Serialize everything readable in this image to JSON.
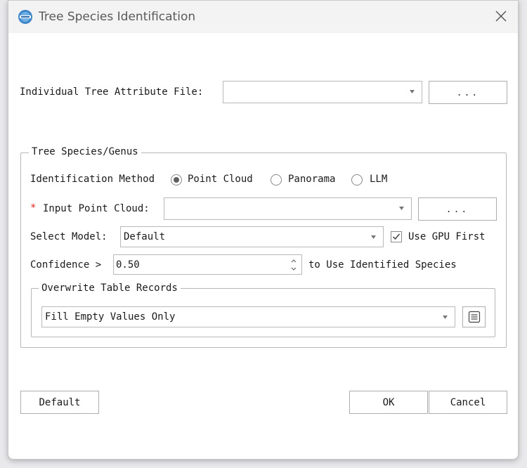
{
  "window": {
    "title": "Tree Species Identification",
    "icon": "app-logo-icon"
  },
  "attribute_file": {
    "label": "Individual Tree Attribute File:",
    "value": "",
    "browse_label": "..."
  },
  "species_group": {
    "title": "Tree Species/Genus",
    "method_label": "Identification Method",
    "methods": [
      {
        "label": "Point Cloud",
        "selected": true
      },
      {
        "label": "Panorama",
        "selected": false
      },
      {
        "label": "LLM",
        "selected": false
      }
    ],
    "required_marker": "*",
    "point_cloud_label": "Input Point Cloud:",
    "point_cloud_value": "",
    "point_cloud_browse": "...",
    "model_label": "Select Model:",
    "model_value": "Default",
    "gpu_label": "Use GPU First",
    "gpu_checked": true,
    "confidence_label": "Confidence >",
    "confidence_value": "0.50",
    "confidence_suffix": "to Use Identified Species",
    "overwrite_group": {
      "title": "Overwrite Table Records",
      "value": "Fill Empty Values Only",
      "icon": "list-icon"
    }
  },
  "footer": {
    "default_label": "Default",
    "ok_label": "OK",
    "cancel_label": "Cancel"
  },
  "colors": {
    "accent_required": "#e02020",
    "background": "#e9e9ec",
    "dialog": "#ffffff"
  }
}
